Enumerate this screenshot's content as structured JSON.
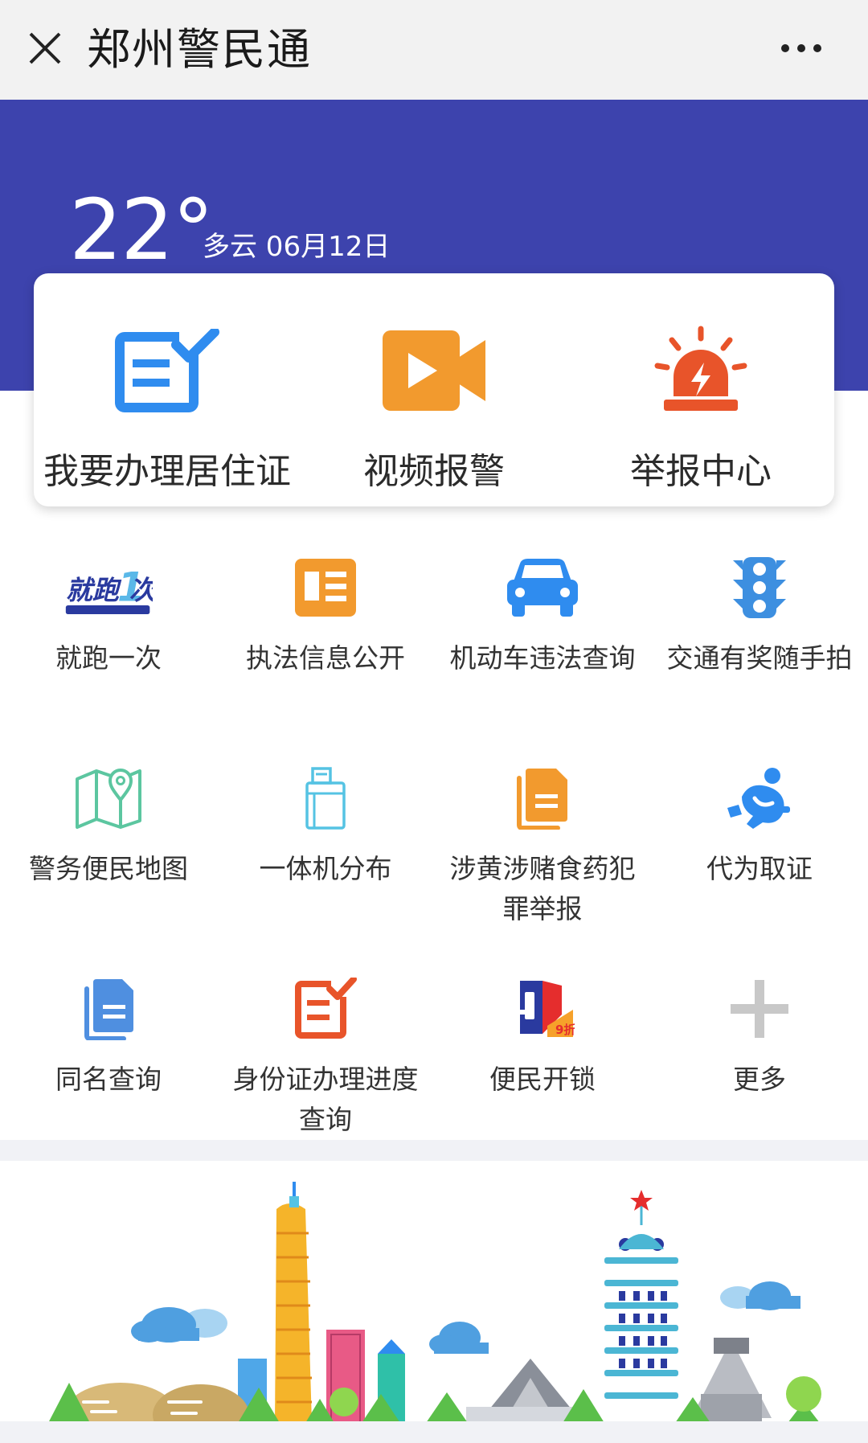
{
  "topbar": {
    "title": "郑州警民通"
  },
  "weather": {
    "temperature": "22°",
    "condition_date": "多云 06月12日"
  },
  "quick_actions": [
    {
      "label": "我要办理居住证",
      "icon": "residence-permit-form-icon",
      "color": "#2f8cef"
    },
    {
      "label": "视频报警",
      "icon": "video-camera-icon",
      "color": "#f29a2e"
    },
    {
      "label": "举报中心",
      "icon": "alarm-siren-icon",
      "color": "#e8542a"
    }
  ],
  "services": [
    {
      "label": "就跑一次",
      "icon": "run-once-logo-icon"
    },
    {
      "label": "执法信息公开",
      "icon": "id-card-icon"
    },
    {
      "label": "机动车违法查询",
      "icon": "car-icon"
    },
    {
      "label": "交通有奖随手拍",
      "icon": "traffic-light-icon"
    },
    {
      "label": "警务便民地图",
      "icon": "map-pin-icon"
    },
    {
      "label": "一体机分布",
      "icon": "kiosk-machine-icon"
    },
    {
      "label": "涉黄涉赌食药犯罪举报",
      "icon": "document-report-icon"
    },
    {
      "label": "代为取证",
      "icon": "running-man-icon"
    },
    {
      "label": "同名查询",
      "icon": "files-icon"
    },
    {
      "label": "身份证办理进度查询",
      "icon": "edit-form-icon"
    },
    {
      "label": "便民开锁",
      "icon": "unlock-key-icon"
    },
    {
      "label": "更多",
      "icon": "plus-icon"
    }
  ],
  "run_once_logo": {
    "big": "就跑",
    "num": "1",
    "tail": "次"
  },
  "unlock_badge": "9折",
  "colors": {
    "header_blue": "#3d43ad",
    "icon_blue": "#2f8cef",
    "icon_orange": "#f29a2e",
    "icon_red": "#e8542a",
    "icon_green": "#5cc6a0",
    "plus_gray": "#c8c8c8"
  }
}
